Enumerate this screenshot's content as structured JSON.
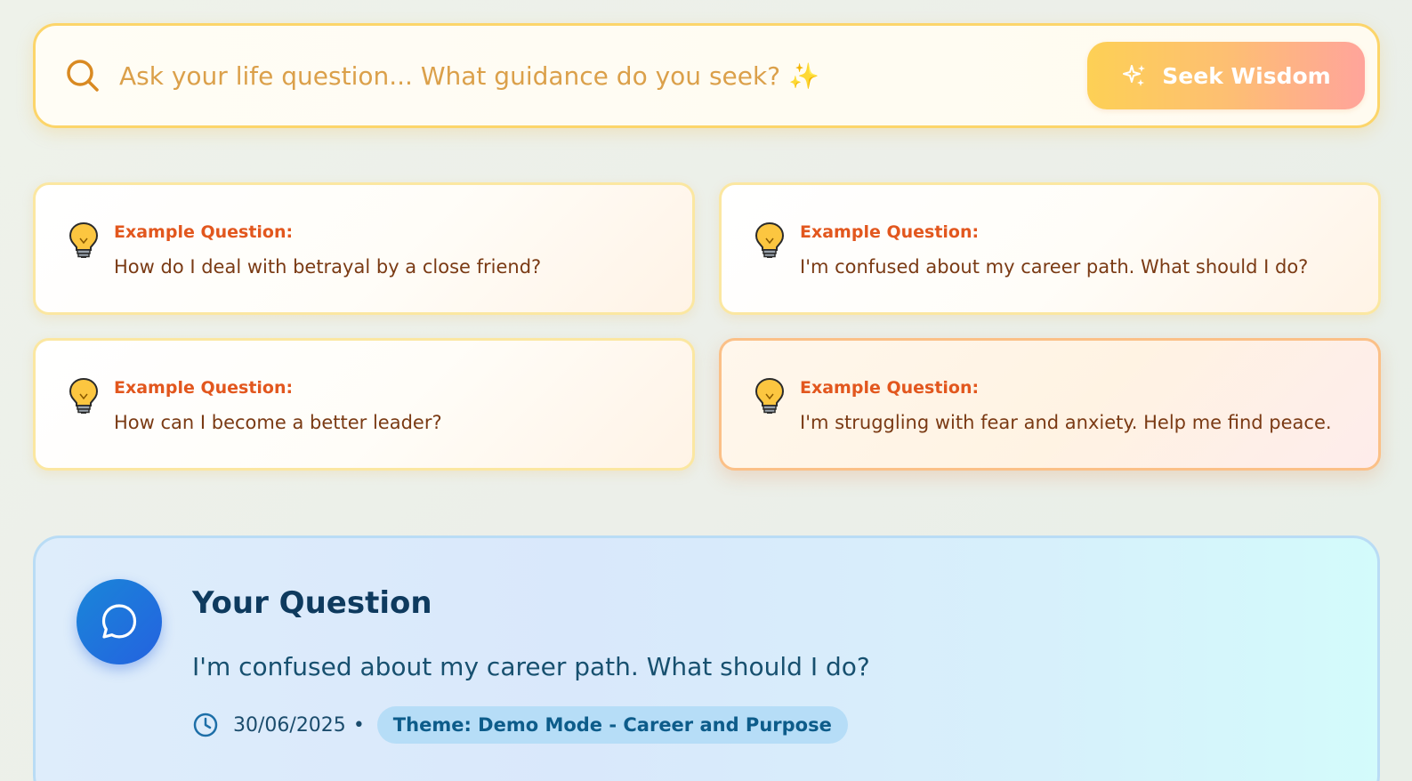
{
  "search": {
    "placeholder": "Ask your life question... What guidance do you seek? ✨",
    "button_label": "Seek Wisdom"
  },
  "examples": [
    {
      "label": "Example Question:",
      "text": "How do I deal with betrayal by a close friend?"
    },
    {
      "label": "Example Question:",
      "text": "I'm confused about my career path. What should I do?"
    },
    {
      "label": "Example Question:",
      "text": "How can I become a better leader?"
    },
    {
      "label": "Example Question:",
      "text": "I'm struggling with fear and anxiety. Help me find peace."
    }
  ],
  "question_panel": {
    "title": "Your Question",
    "question": "I'm confused about my career path. What should I do?",
    "date": "30/06/2025",
    "separator": "•",
    "theme": "Theme: Demo Mode - Career and Purpose"
  },
  "icons": {
    "search": "search-icon",
    "sparkle": "sparkle-icon",
    "bulb": "lightbulb-icon",
    "chat": "chat-bubble-icon",
    "clock": "clock-icon"
  },
  "colors": {
    "accent_orange": "#e2571e",
    "search_border": "#fcd56a",
    "primary_blue": "#2462e0",
    "badge_bg": "#b6ddf7"
  }
}
